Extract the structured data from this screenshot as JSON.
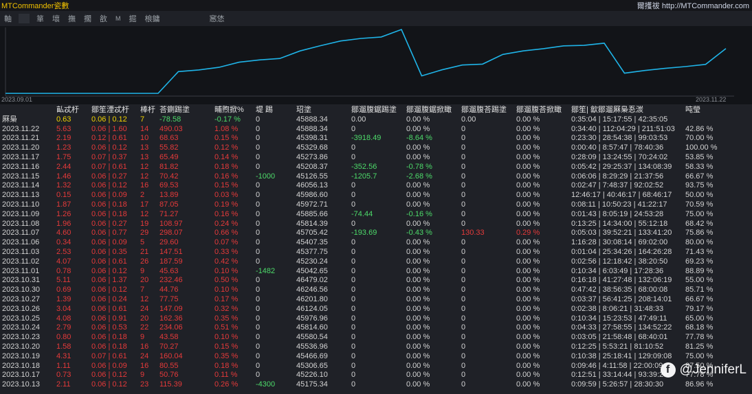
{
  "window": {
    "title": "MTCommander瓷數",
    "site": "爾擭祓 http://MTCommander.com"
  },
  "toolbar": {
    "items": [
      "軸",
      "箪",
      "壞",
      "撫",
      "擱",
      "敋",
      "M",
      "掘",
      "桹鏞",
      "窸恷"
    ]
  },
  "chart": {
    "x_start_label": "2023.09.01",
    "x_end_label": "2023.11.22",
    "line_color": "#1fb4e8"
  },
  "table": {
    "headers": [
      "",
      "畆忒杅",
      "鄒笙湮忒杅",
      "棒杅",
      "荅鍘踢塗",
      "晡煦掀%",
      "堤 踢",
      "玿塗",
      "鄒遛腹鋸踢塗",
      "鄒遛腹鋸掀瞰",
      "鄒遛腹荅踢塗",
      "鄒遛腹荅掀瞰",
      "鄒笙| 歙鄒遛厤梟忢湠",
      "吨瑩"
    ],
    "summary": {
      "label": "厤梟",
      "c1": "0.63",
      "c2": "0.06 | 0.12",
      "c3": "7",
      "c4": "-78.58",
      "c5": "-0.17 %",
      "c6": "0",
      "c7": "45888.34",
      "c8": "0.00",
      "c9": "0.00 %",
      "c10": "0.00",
      "c11": "0.00 %",
      "c12": "0:35:04 | 15:17:55 | 42:35:05",
      "c13": ""
    },
    "rows": [
      [
        "2023.11.22",
        "5.63",
        "0.06 | 1.60",
        "14",
        "490.03",
        "1.08 %",
        "0",
        "45888.34",
        "0",
        "0.00 %",
        "0",
        "0.00 %",
        "0:34:40 | 112:04:29 | 211:51:03",
        "42.86 %"
      ],
      [
        "2023.11.21",
        "2.19",
        "0.12 | 0.61",
        "10",
        "68.63",
        "0.15 %",
        "0",
        "45398.31",
        "-3918.49",
        "-8.64 %",
        "0",
        "0.00 %",
        "0:23:30 | 28:54:38 | 99:03:53",
        "70.00 %"
      ],
      [
        "2023.11.20",
        "1.23",
        "0.06 | 0.12",
        "13",
        "55.82",
        "0.12 %",
        "0",
        "45329.68",
        "0",
        "0.00 %",
        "0",
        "0.00 %",
        "0:00:40 | 8:57:47 | 78:40:36",
        "100.00 %"
      ],
      [
        "2023.11.17",
        "1.75",
        "0.07 | 0.37",
        "13",
        "65.49",
        "0.14 %",
        "0",
        "45273.86",
        "0",
        "0.00 %",
        "0",
        "0.00 %",
        "0:28:09 | 13:24:55 | 70:24:02",
        "53.85 %"
      ],
      [
        "2023.11.16",
        "2.44",
        "0.07 | 0.61",
        "12",
        "81.82",
        "0.18 %",
        "0",
        "45208.37",
        "-352.56",
        "-0.78 %",
        "0",
        "0.00 %",
        "0:05:42 | 29:25:37 | 134:08:39",
        "58.33 %"
      ],
      [
        "2023.11.15",
        "1.46",
        "0.06 | 0.27",
        "12",
        "70.42",
        "0.16 %",
        "-1000",
        "45126.55",
        "-1205.7",
        "-2.68 %",
        "0",
        "0.00 %",
        "0:06:06 | 8:29:29 | 21:37:56",
        "66.67 %"
      ],
      [
        "2023.11.14",
        "1.32",
        "0.06 | 0.12",
        "16",
        "69.53",
        "0.15 %",
        "0",
        "46056.13",
        "0",
        "0.00 %",
        "0",
        "0.00 %",
        "0:02:47 | 7:48:37 | 92:02:52",
        "93.75 %"
      ],
      [
        "2023.11.13",
        "0.15",
        "0.06 | 0.09",
        "2",
        "13.89",
        "0.03 %",
        "0",
        "45986.60",
        "0",
        "0.00 %",
        "0",
        "0.00 %",
        "12:46:17 | 40:46:17 | 68:46:17",
        "50.00 %"
      ],
      [
        "2023.11.10",
        "1.87",
        "0.06 | 0.18",
        "17",
        "87.05",
        "0.19 %",
        "0",
        "45972.71",
        "0",
        "0.00 %",
        "0",
        "0.00 %",
        "0:08:11 | 10:50:23 | 41:22:17",
        "70.59 %"
      ],
      [
        "2023.11.09",
        "1.26",
        "0.06 | 0.18",
        "12",
        "71.27",
        "0.16 %",
        "0",
        "45885.66",
        "-74.44",
        "-0.16 %",
        "0",
        "0.00 %",
        "0:01:43 | 8:05:19 | 24:53:28",
        "75.00 %"
      ],
      [
        "2023.11.08",
        "1.96",
        "0.06 | 0.27",
        "19",
        "108.97",
        "0.24 %",
        "0",
        "45814.39",
        "0",
        "0.00 %",
        "0",
        "0.00 %",
        "0:13:25 | 14:34:00 | 55:12:18",
        "68.42 %"
      ],
      [
        "2023.11.07",
        "4.60",
        "0.06 | 0.77",
        "29",
        "298.07",
        "0.66 %",
        "0",
        "45705.42",
        "-193.69",
        "-0.43 %",
        "130.33",
        "0.29 %",
        "0:05:03 | 39:52:21 | 133:41:20",
        "75.86 %"
      ],
      [
        "2023.11.06",
        "0.34",
        "0.06 | 0.09",
        "5",
        "29.60",
        "0.07 %",
        "0",
        "45407.35",
        "0",
        "0.00 %",
        "0",
        "0.00 %",
        "1:16:28 | 30:08:14 | 69:02:00",
        "80.00 %"
      ],
      [
        "2023.11.03",
        "2.53",
        "0.06 | 0.35",
        "21",
        "147.51",
        "0.33 %",
        "0",
        "45377.75",
        "0",
        "0.00 %",
        "0",
        "0.00 %",
        "0:01:04 | 25:34:26 | 164:26:28",
        "71.43 %"
      ],
      [
        "2023.11.02",
        "4.07",
        "0.06 | 0.61",
        "26",
        "187.59",
        "0.42 %",
        "0",
        "45230.24",
        "0",
        "0.00 %",
        "0",
        "0.00 %",
        "0:02:56 | 12:18:42 | 38:20:50",
        "69.23 %"
      ],
      [
        "2023.11.01",
        "0.78",
        "0.06 | 0.12",
        "9",
        "45.63",
        "0.10 %",
        "-1482",
        "45042.65",
        "0",
        "0.00 %",
        "0",
        "0.00 %",
        "0:10:34 | 6:03:49 | 17:28:36",
        "88.89 %"
      ],
      [
        "2023.10.31",
        "5.11",
        "0.06 | 1.37",
        "20",
        "232.46",
        "0.50 %",
        "0",
        "46479.02",
        "0",
        "0.00 %",
        "0",
        "0.00 %",
        "0:16:18 | 41:27:48 | 132:06:19",
        "55.00 %"
      ],
      [
        "2023.10.30",
        "0.69",
        "0.06 | 0.12",
        "7",
        "44.76",
        "0.10 %",
        "0",
        "46246.56",
        "0",
        "0.00 %",
        "0",
        "0.00 %",
        "0:47:42 | 38:56:35 | 68:00:08",
        "85.71 %"
      ],
      [
        "2023.10.27",
        "1.39",
        "0.06 | 0.24",
        "12",
        "77.75",
        "0.17 %",
        "0",
        "46201.80",
        "0",
        "0.00 %",
        "0",
        "0.00 %",
        "0:03:37 | 56:41:25 | 208:14:01",
        "66.67 %"
      ],
      [
        "2023.10.26",
        "3.04",
        "0.06 | 0.61",
        "24",
        "147.09",
        "0.32 %",
        "0",
        "46124.05",
        "0",
        "0.00 %",
        "0",
        "0.00 %",
        "0:02:38 | 8:06:21 | 31:48:33",
        "79.17 %"
      ],
      [
        "2023.10.25",
        "4.08",
        "0.06 | 0.91",
        "20",
        "162.36",
        "0.35 %",
        "0",
        "45976.96",
        "0",
        "0.00 %",
        "0",
        "0.00 %",
        "0:10:34 | 15:23:53 | 47:49:11",
        "65.00 %"
      ],
      [
        "2023.10.24",
        "2.79",
        "0.06 | 0.53",
        "22",
        "234.06",
        "0.51 %",
        "0",
        "45814.60",
        "0",
        "0.00 %",
        "0",
        "0.00 %",
        "0:04:33 | 27:58:55 | 134:52:22",
        "68.18 %"
      ],
      [
        "2023.10.23",
        "0.80",
        "0.06 | 0.18",
        "9",
        "43.58",
        "0.10 %",
        "0",
        "45580.54",
        "0",
        "0.00 %",
        "0",
        "0.00 %",
        "0:03:05 | 21:58:48 | 68:40:01",
        "77.78 %"
      ],
      [
        "2023.10.20",
        "1.58",
        "0.06 | 0.18",
        "16",
        "70.27",
        "0.15 %",
        "0",
        "45536.96",
        "0",
        "0.00 %",
        "0",
        "0.00 %",
        "0:12:25 | 5:53:21 | 81:10:52",
        "81.25 %"
      ],
      [
        "2023.10.19",
        "4.31",
        "0.07 | 0.61",
        "24",
        "160.04",
        "0.35 %",
        "0",
        "45466.69",
        "0",
        "0.00 %",
        "0",
        "0.00 %",
        "0:10:38 | 25:18:41 | 129:09:08",
        "75.00 %"
      ],
      [
        "2023.10.18",
        "1.11",
        "0.06 | 0.09",
        "16",
        "80.55",
        "0.18 %",
        "0",
        "45306.65",
        "0",
        "0.00 %",
        "0",
        "0.00 %",
        "0:09:46 | 4:11:58 | 22:00:09",
        "87.50 %"
      ],
      [
        "2023.10.17",
        "0.73",
        "0.06 | 0.12",
        "9",
        "50.76",
        "0.11 %",
        "0",
        "45226.10",
        "0",
        "0.00 %",
        "0",
        "0.00 %",
        "0:12:51 | 33:14:44 | 93:39:28",
        "77.78 %"
      ],
      [
        "2023.10.13",
        "2.11",
        "0.06 | 0.12",
        "23",
        "115.39",
        "0.26 %",
        "-4300",
        "45175.34",
        "0",
        "0.00 %",
        "0",
        "0.00 %",
        "0:09:59 | 5:26:57 | 28:30:30",
        "86.96 %"
      ]
    ]
  },
  "watermark": {
    "icon": "facebook-icon",
    "text": "@JenniferL"
  },
  "colors": {
    "red": "#e63a3a",
    "green": "#4ddb6a",
    "yellow": "#f2d400",
    "title": "#f2c200"
  }
}
